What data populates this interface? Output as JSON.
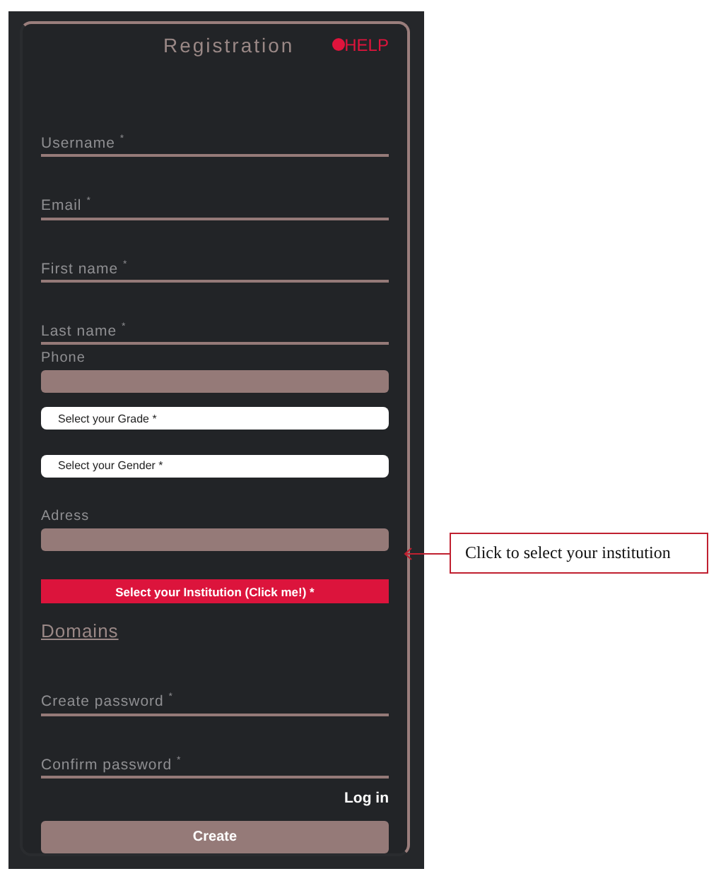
{
  "form": {
    "title": "Registration",
    "help": "HELP",
    "fields": [
      {
        "kind": "underline",
        "label": "Username $^{*}$"
      },
      {
        "kind": "underline",
        "label": "Email $^{*}$"
      },
      {
        "kind": "underline",
        "label": "First name $^{*}$"
      },
      {
        "kind": "underline",
        "label": "Last name $^{*}$"
      },
      {
        "kind": "filled",
        "label": "Phone"
      },
      {
        "kind": "select",
        "label": "Select your Grade *"
      },
      {
        "kind": "select",
        "label": "Select your Gender *"
      },
      {
        "kind": "filled",
        "label": "Adress"
      },
      {
        "kind": "action",
        "label": "Select your Institution (Click me!) *"
      },
      {
        "kind": "link",
        "label": "Domains"
      },
      {
        "kind": "underline",
        "label": "Create password $^{*}$"
      },
      {
        "kind": "underline",
        "label": "Confirm password $^{*}$"
      }
    ],
    "login": "Log in",
    "submit": "Create"
  },
  "callout": {
    "text": "Click  to select your institution"
  }
}
